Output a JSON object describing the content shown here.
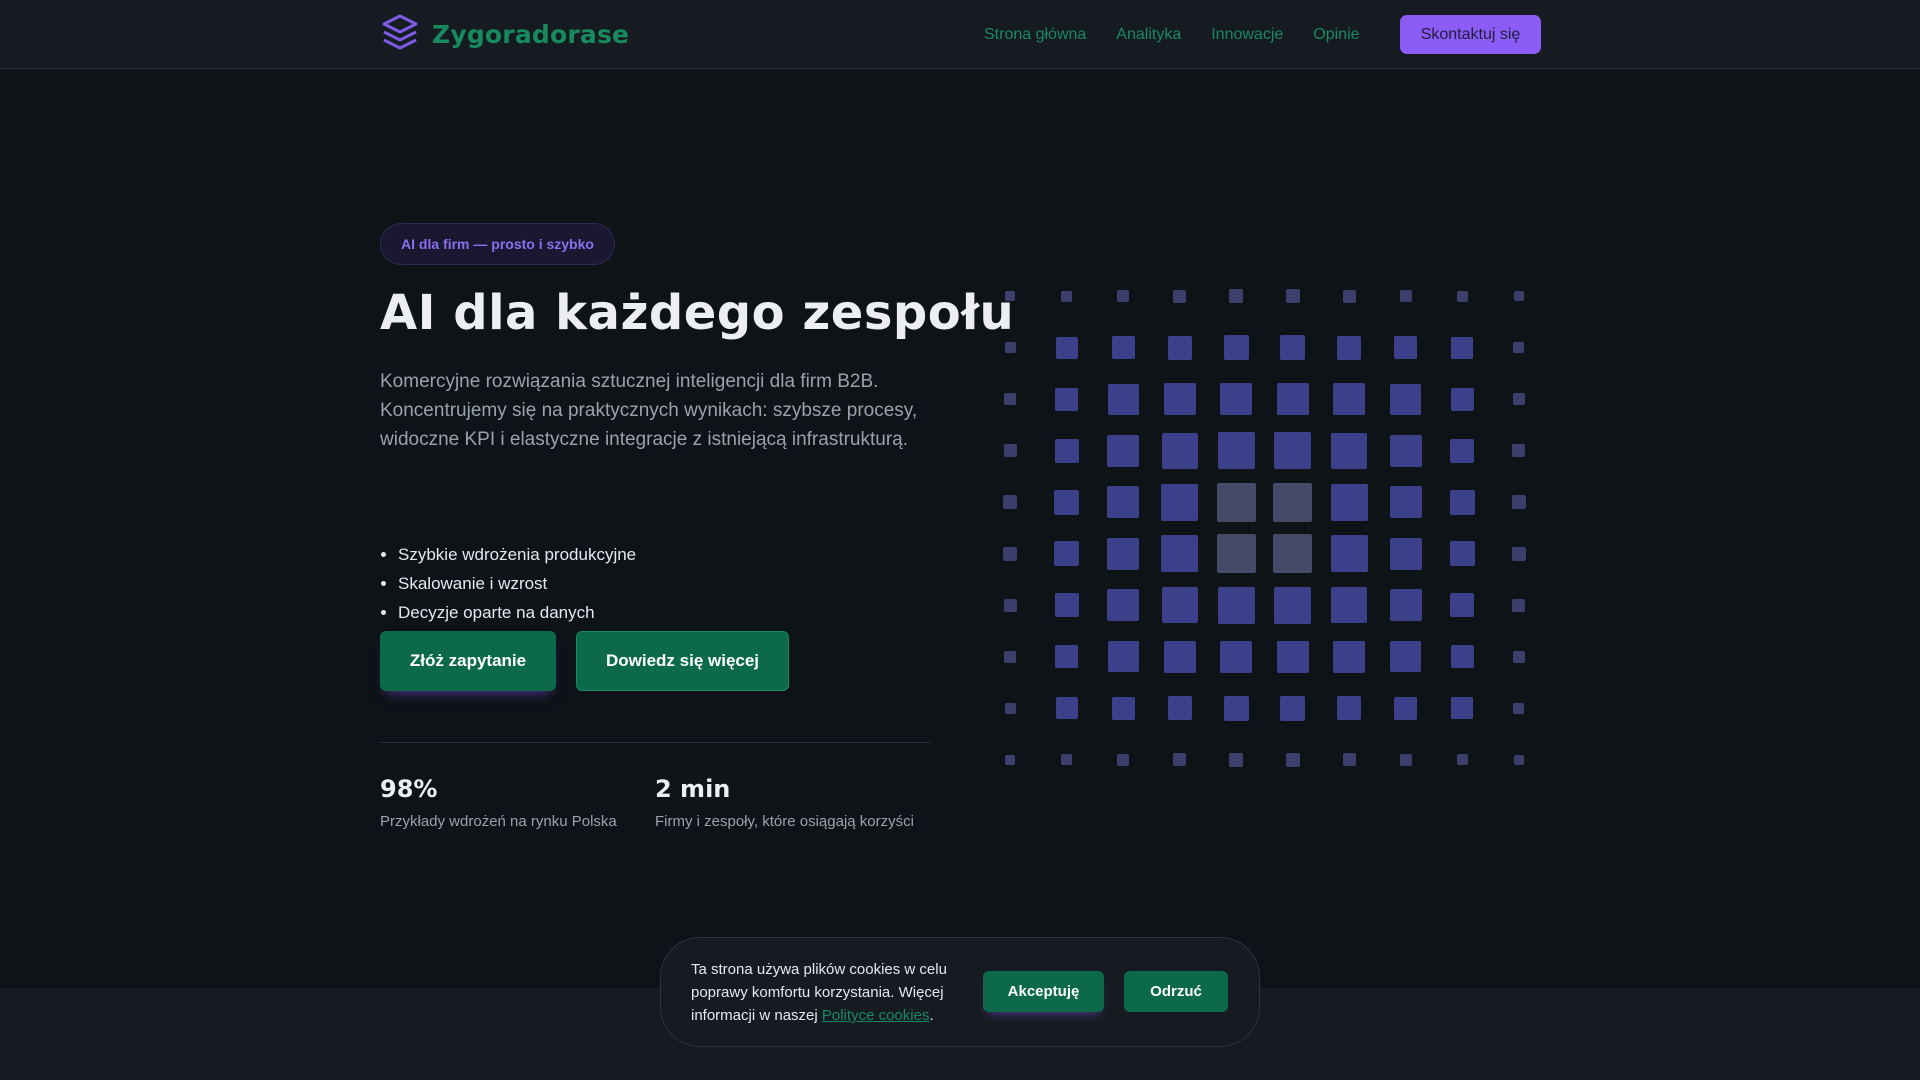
{
  "header": {
    "brand": "Zygoradorase",
    "nav": [
      "Strona główna",
      "Analityka",
      "Innowacje",
      "Opinie"
    ],
    "contact_label": "Skontaktuj się"
  },
  "hero": {
    "badge": "AI dla firm — prosto i szybko",
    "title": "AI dla każdego zespołu",
    "description": "Komercyjne rozwiązania sztucznej inteligencji dla firm B2B. Koncentrujemy się na praktycznych wynikach: szybsze procesy, widoczne KPI i elastyczne integracje z istniejącą infrastrukturą.",
    "features": [
      "Szybkie wdrożenia produkcyjne",
      "Skalowanie i wzrost",
      "Decyzje oparte na danych"
    ],
    "cta_primary": "Złóż zapytanie",
    "cta_secondary": "Dowiedz się więcej"
  },
  "stats": [
    {
      "value": "98%",
      "label": "Przykłady wdrożeń na rynku Polska"
    },
    {
      "value": "2 min",
      "label": "Firmy i zespoły, które osiągają korzyści"
    }
  ],
  "cookie": {
    "text": "Ta strona używa plików cookies w celu poprawy komfortu korzystania. Więcej informacji w naszej ",
    "link": "Polityce cookies",
    "suffix": ".",
    "accept": "Akceptuję",
    "reject": "Odrzuć"
  },
  "colors": {
    "accent_green": "#178a5e",
    "button_green": "#0c6a4b",
    "accent_purple": "#8b5cf6",
    "tile_blue": "#3c3f8a",
    "tile_gray": "#4a4d6e"
  },
  "icons": {
    "brand": "layers-icon"
  }
}
